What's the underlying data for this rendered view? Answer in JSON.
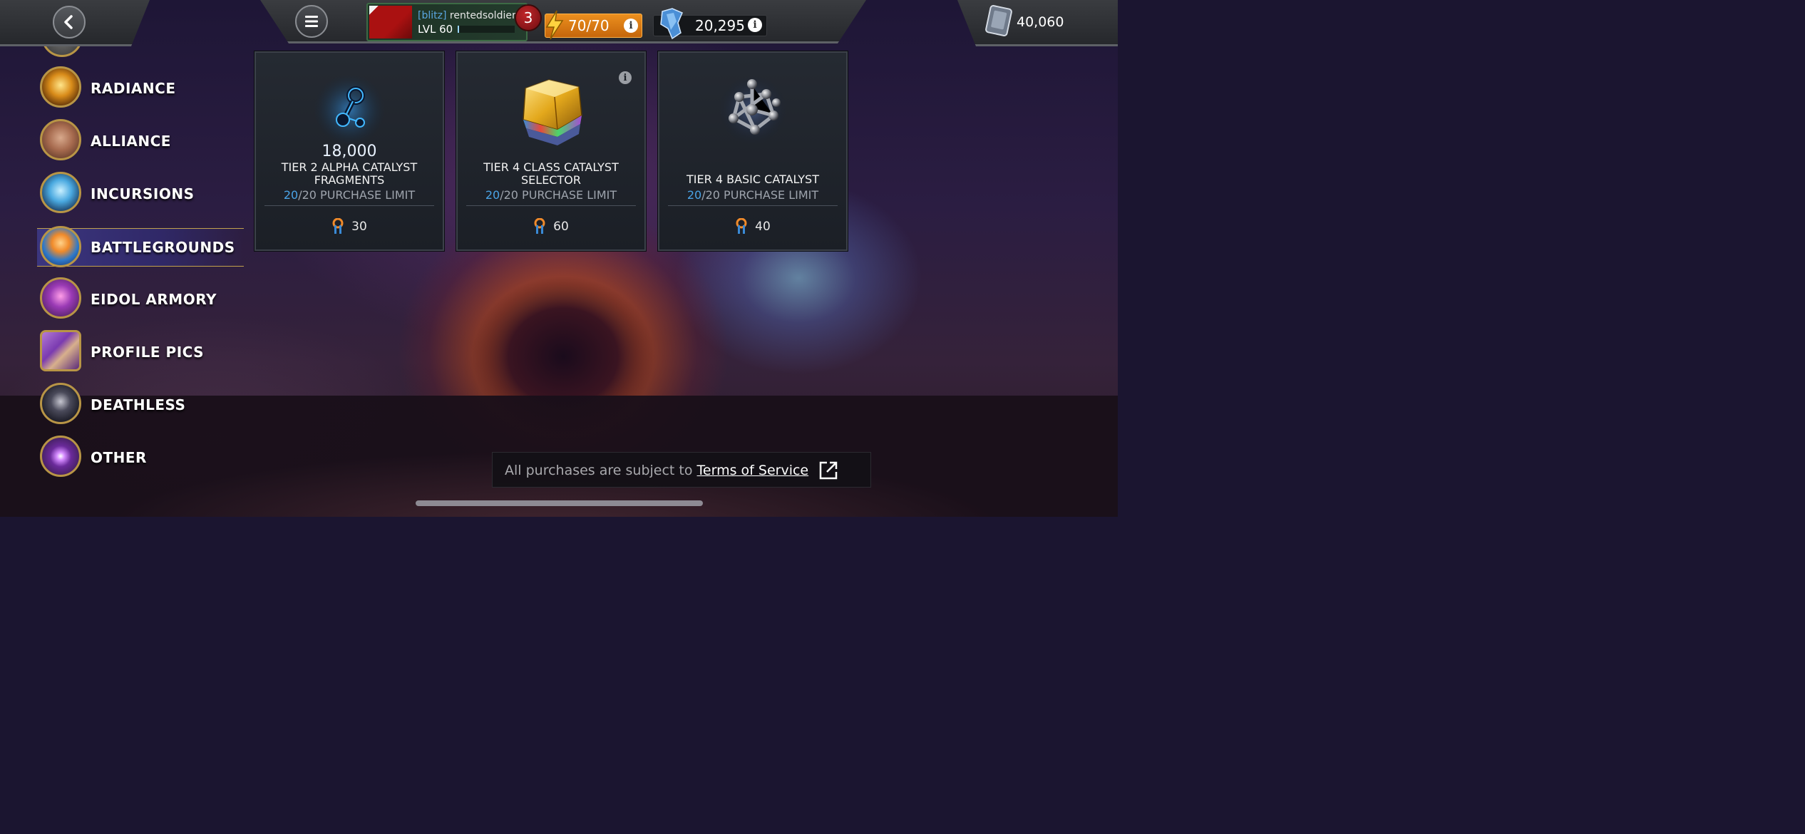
{
  "topbar": {
    "profile": {
      "tag": "[blitz]",
      "name": "rentedsoldier2",
      "level": "LVL 60",
      "xp_fraction": 0.02
    },
    "notifications": "3",
    "energy": "70/70",
    "crystals": "20,295",
    "units": "40,060"
  },
  "sidebar": {
    "items": [
      {
        "label": "RADIANCE"
      },
      {
        "label": "ALLIANCE"
      },
      {
        "label": "INCURSIONS"
      },
      {
        "label": "BATTLEGROUNDS"
      },
      {
        "label": "EIDOL ARMORY"
      },
      {
        "label": "PROFILE PICS"
      },
      {
        "label": "DEATHLESS"
      },
      {
        "label": "OTHER"
      }
    ],
    "active": "BATTLEGROUNDS"
  },
  "cards": [
    {
      "amount": "18,000",
      "title": "TIER 2 ALPHA CATALYST FRAGMENTS",
      "limit_current": "20",
      "limit_rest": "/20 PURCHASE LIMIT",
      "price": "30"
    },
    {
      "amount": "",
      "title": "TIER 4 CLASS CATALYST SELECTOR",
      "limit_current": "20",
      "limit_rest": "/20 PURCHASE LIMIT",
      "price": "60"
    },
    {
      "amount": "",
      "title": "TIER 4 BASIC CATALYST",
      "limit_current": "20",
      "limit_rest": "/20 PURCHASE LIMIT",
      "price": "40"
    }
  ],
  "footer": {
    "prefix": "All purchases are subject to ",
    "link": "Terms of Service"
  },
  "colors": {
    "accent_blue": "#4aa3e6",
    "energy_orange": "#e0811a",
    "active_gold": "#c2a24d"
  },
  "icons": [
    "back-arrow-icon",
    "menu-icon",
    "lightning-icon",
    "info-icon",
    "crystal-shard-icon",
    "units-icon",
    "battlegrounds-token-icon",
    "external-link-icon"
  ]
}
